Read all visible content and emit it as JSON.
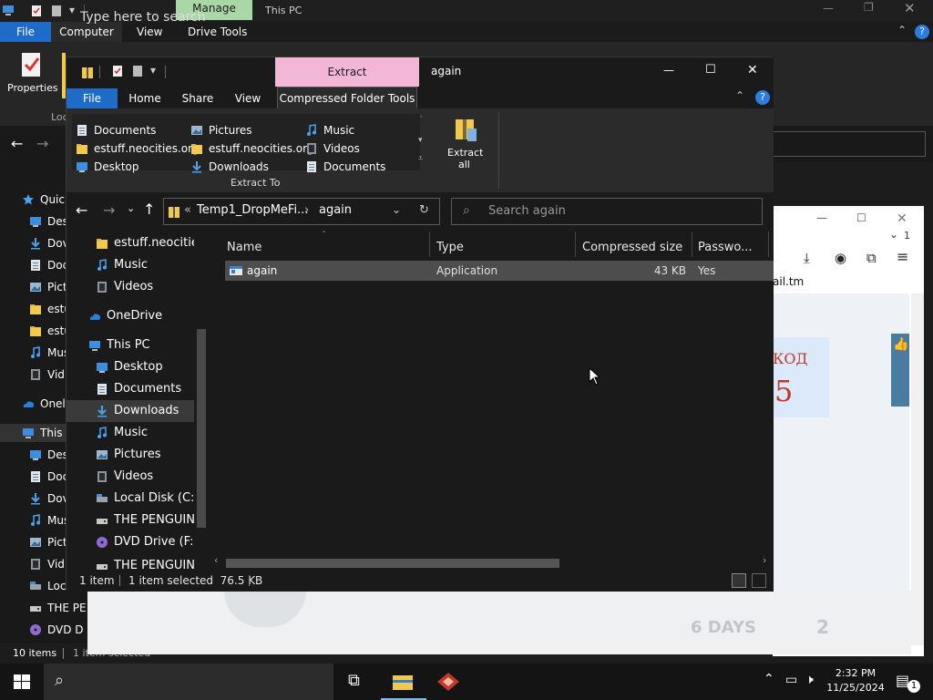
{
  "background_window": {
    "title_context_tab": "Manage",
    "title": "This PC",
    "tabs": [
      "File",
      "Computer",
      "View",
      "Drive Tools"
    ],
    "ribbon_properties_label": "Properties",
    "ribbon_partial": "Loc",
    "sidebar": [
      {
        "icon": "star-icon",
        "label": "Quic"
      },
      {
        "icon": "desktop-icon",
        "label": "Des"
      },
      {
        "icon": "download-icon",
        "label": "Dov"
      },
      {
        "icon": "document-icon",
        "label": "Doc"
      },
      {
        "icon": "pictures-icon",
        "label": "Pict"
      },
      {
        "icon": "folder-icon",
        "label": "estu"
      },
      {
        "icon": "folder-icon",
        "label": "estu"
      },
      {
        "icon": "music-icon",
        "label": "Mus"
      },
      {
        "icon": "videos-icon",
        "label": "Vid"
      },
      {
        "icon": "onedrive-icon",
        "label": "Onel"
      },
      {
        "icon": "pc-icon",
        "label": "This"
      },
      {
        "icon": "desktop-icon",
        "label": "Des"
      },
      {
        "icon": "document-icon",
        "label": "Doc"
      },
      {
        "icon": "download-icon",
        "label": "Dov"
      },
      {
        "icon": "music-icon",
        "label": "Mus"
      },
      {
        "icon": "pictures-icon",
        "label": "Pict"
      },
      {
        "icon": "videos-icon",
        "label": "Vid"
      },
      {
        "icon": "disk-icon",
        "label": "Loc"
      },
      {
        "icon": "drive-icon",
        "label": "THE PE"
      },
      {
        "icon": "dvd-icon",
        "label": "DVD D"
      }
    ],
    "status_items": "10 items",
    "status_selected": "1 item selected"
  },
  "browser": {
    "url_partial": "ail.tm",
    "promo_text": "КОД",
    "promo_number": "5",
    "banner_days": "6 DAYS",
    "banner_number": "2"
  },
  "dialog": {
    "context_tab": "Extract",
    "title": "again",
    "tabs": {
      "file": "File",
      "home": "Home",
      "share": "Share",
      "view": "View",
      "compressed": "Compressed Folder Tools"
    },
    "destinations": [
      {
        "icon": "document-icon",
        "label": "Documents"
      },
      {
        "icon": "folder-icon",
        "label": "estuff.neocities.org"
      },
      {
        "icon": "desktop-icon",
        "label": "Desktop"
      },
      {
        "icon": "pictures-icon",
        "label": "Pictures"
      },
      {
        "icon": "folder-icon",
        "label": "estuff.neocities.org"
      },
      {
        "icon": "download-icon",
        "label": "Downloads"
      },
      {
        "icon": "music-icon",
        "label": "Music"
      },
      {
        "icon": "videos-icon",
        "label": "Videos"
      },
      {
        "icon": "document-icon",
        "label": "Documents"
      }
    ],
    "extract_to_label": "Extract To",
    "extract_all_line1": "Extract",
    "extract_all_line2": "all",
    "address": {
      "prefix": "«",
      "segment1": "Temp1_DropMeFi...",
      "separator": "›",
      "segment2": "again"
    },
    "search_placeholder": "Search again",
    "left_nav": [
      {
        "icon": "folder-icon",
        "label": "estuff.neocities",
        "indent": 1
      },
      {
        "icon": "music-icon",
        "label": "Music",
        "indent": 1
      },
      {
        "icon": "videos-icon",
        "label": "Videos",
        "indent": 1
      },
      {
        "icon": "onedrive-icon",
        "label": "OneDrive",
        "indent": 0
      },
      {
        "icon": "pc-icon",
        "label": "This PC",
        "indent": 0
      },
      {
        "icon": "desktop-icon",
        "label": "Desktop",
        "indent": 1
      },
      {
        "icon": "document-icon",
        "label": "Documents",
        "indent": 1
      },
      {
        "icon": "download-icon",
        "label": "Downloads",
        "indent": 1
      },
      {
        "icon": "music-icon",
        "label": "Music",
        "indent": 1
      },
      {
        "icon": "pictures-icon",
        "label": "Pictures",
        "indent": 1
      },
      {
        "icon": "videos-icon",
        "label": "Videos",
        "indent": 1
      },
      {
        "icon": "disk-icon",
        "label": "Local Disk (C:)",
        "indent": 1
      },
      {
        "icon": "drive-icon",
        "label": "THE PENGUIN",
        "indent": 1
      },
      {
        "icon": "dvd-icon",
        "label": "DVD Drive (F:) I",
        "indent": 1
      },
      {
        "icon": "drive-icon",
        "label": "THE PENGUIN (",
        "indent": 1
      }
    ],
    "columns": [
      "Name",
      "Type",
      "Compressed size",
      "Passwo..."
    ],
    "rows": [
      {
        "name": "again",
        "type": "Application",
        "size": "43 KB",
        "password": "Yes"
      }
    ],
    "status": {
      "count": "1 item",
      "selected": "1 item selected  76.5 KB"
    }
  },
  "taskbar": {
    "search_placeholder": "Type here to search",
    "time": "2:32 PM",
    "date": "11/25/2024",
    "notification_count": "1"
  },
  "colors": {
    "accent_blue": "#1e6cc8",
    "extract_pink": "#f3b6d7",
    "manage_green": "#a9d8a6",
    "folder_yellow": "#f2c94c"
  }
}
